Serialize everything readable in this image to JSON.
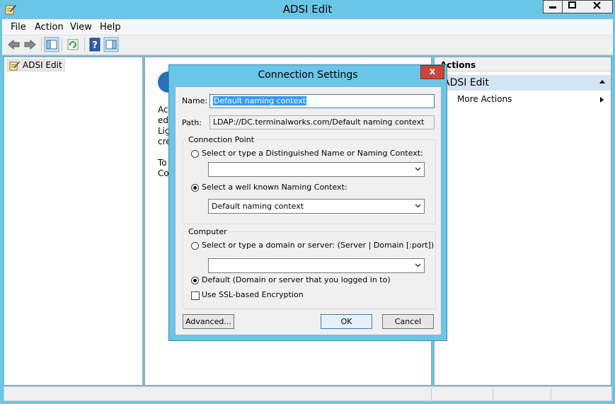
{
  "window": {
    "title": "ADSI Edit"
  },
  "menu": {
    "file": "File",
    "action": "Action",
    "view": "View",
    "help": "Help"
  },
  "tree": {
    "root_label": "ADSI Edit"
  },
  "center": {
    "lines": [
      "Ac",
      "edi",
      "Lig",
      "cre",
      "To",
      "Co"
    ]
  },
  "actions": {
    "header": "Actions",
    "group_title": "ADSI Edit",
    "more_actions": "More Actions"
  },
  "dialog": {
    "title": "Connection Settings",
    "close_label": "x",
    "name_label": "Name:",
    "name_value": "Default naming context",
    "path_label": "Path:",
    "path_value": "LDAP://DC.terminalworks.com/Default naming context",
    "connection_point": {
      "title": "Connection Point",
      "option_dn": "Select or type a Distinguished Name or Naming Context:",
      "dn_value": "",
      "option_known": "Select a well known Naming Context:",
      "known_value": "Default naming context",
      "selected": "known"
    },
    "computer": {
      "title": "Computer",
      "option_server": "Select or type a domain or server: (Server | Domain [:port])",
      "server_value": "",
      "option_default": "Default (Domain or server that you logged in to)",
      "selected": "default",
      "ssl_label": "Use SSL-based Encryption",
      "ssl_checked": false
    },
    "buttons": {
      "advanced": "Advanced...",
      "ok": "OK",
      "cancel": "Cancel"
    }
  },
  "colors": {
    "title_bar": "#6ac6e6",
    "close_button": "#c7473a",
    "selection": "#3399ff"
  }
}
